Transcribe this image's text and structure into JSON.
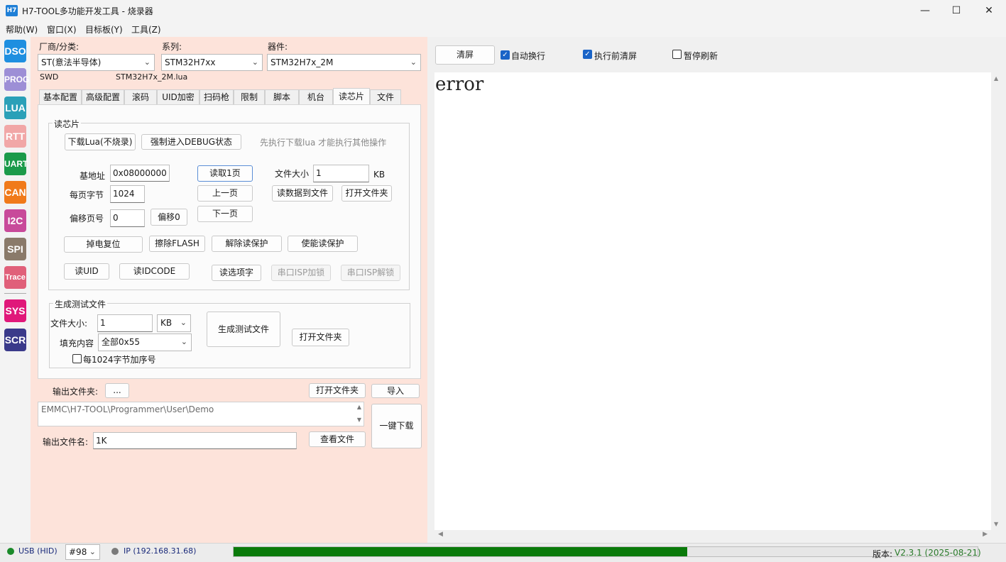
{
  "window": {
    "app_icon_text": "H7",
    "title": "H7-TOOL多功能开发工具 - 烧录器",
    "minimize": "—",
    "maximize": "☐",
    "close": "✕"
  },
  "menu": [
    {
      "label": "帮助(W)"
    },
    {
      "label": "窗口(X)"
    },
    {
      "label": "目标板(Y)"
    },
    {
      "label": "工具(Z)"
    }
  ],
  "sidebar": [
    {
      "label": "DSO",
      "color": "#1e8fe0"
    },
    {
      "label": "PROG",
      "color": "#9d8fd6"
    },
    {
      "label": "LUA",
      "color": "#2aa0b8"
    },
    {
      "label": "RTT",
      "color": "#f1a7a7"
    },
    {
      "label": "UART",
      "color": "#1a9a4a"
    },
    {
      "label": "CAN",
      "color": "#f07a1a"
    },
    {
      "label": "I2C",
      "color": "#c84a9a"
    },
    {
      "label": "SPI",
      "color": "#8a7a6a"
    },
    {
      "label": "Trace",
      "color": "#e0607a"
    },
    {
      "label": "SYS",
      "color": "#e0187a"
    },
    {
      "label": "SCR",
      "color": "#3a3a8a"
    }
  ],
  "selectors": {
    "vendor_label": "厂商/分类:",
    "vendor_value": "ST(意法半导体)",
    "series_label": "系列:",
    "series_value": "STM32H7xx",
    "device_label": "器件:",
    "device_value": "STM32H7x_2M",
    "interface": "SWD",
    "lua_file": "STM32H7x_2M.lua"
  },
  "tabs": [
    {
      "label": "基本配置"
    },
    {
      "label": "高级配置"
    },
    {
      "label": "滚码"
    },
    {
      "label": "UID加密"
    },
    {
      "label": "扫码枪"
    },
    {
      "label": "限制"
    },
    {
      "label": "脚本"
    },
    {
      "label": "机台"
    },
    {
      "label": "读芯片"
    },
    {
      "label": "文件"
    }
  ],
  "read_chip": {
    "group_title": "读芯片",
    "download_lua_btn": "下载Lua(不烧录)",
    "force_debug_btn": "强制进入DEBUG状态",
    "hint": "先执行下载lua 才能执行其他操作",
    "base_addr_label": "基地址",
    "base_addr_value": "0x08000000",
    "bytes_per_page_label": "每页字节",
    "bytes_per_page_value": "1024",
    "offset_page_label": "偏移页号",
    "offset_page_value": "0",
    "offset0_btn": "偏移0",
    "read_page_btn": "读取1页",
    "prev_page_btn": "上一页",
    "next_page_btn": "下一页",
    "file_size_label": "文件大小",
    "file_size_value": "1",
    "file_size_unit": "KB",
    "read_to_file_btn": "读数据到文件",
    "open_folder_btn": "打开文件夹",
    "power_reset_btn": "掉电复位",
    "erase_flash_btn": "擦除FLASH",
    "unprotect_btn": "解除读保护",
    "protect_btn": "使能读保护",
    "read_uid_btn": "读UID",
    "read_idcode_btn": "读IDCODE",
    "read_option_btn": "读选项字",
    "isp_lock_btn": "串口ISP加锁",
    "isp_unlock_btn": "串口ISP解锁"
  },
  "gen_test": {
    "group_title": "生成测试文件",
    "size_label": "文件大小:",
    "size_value": "1",
    "unit_value": "KB",
    "fill_label": "填充内容",
    "fill_value": "全部0x55",
    "seq_checkbox_label": "每1024字节加序号",
    "generate_btn": "生成测试文件",
    "open_folder_btn": "打开文件夹"
  },
  "output": {
    "folder_label": "输出文件夹:",
    "browse_btn": "...",
    "open_folder_btn": "打开文件夹",
    "import_btn": "导入",
    "path_value": "EMMC\\H7-TOOL\\Programmer\\User\\Demo",
    "one_click_btn": "一键下载",
    "filename_label": "输出文件名:",
    "filename_value": "1K",
    "view_file_btn": "查看文件"
  },
  "log": {
    "clear_btn": "清屏",
    "auto_wrap_label": "自动换行",
    "auto_wrap_checked": true,
    "clear_before_label": "执行前清屏",
    "clear_before_checked": true,
    "pause_label": "暂停刷新",
    "pause_checked": false,
    "text": "error"
  },
  "status": {
    "usb_label": "USB (HID)",
    "usb_color": "#1a8a2a",
    "device_num": "#98",
    "ip_label": "IP (192.168.31.68)",
    "ip_color": "#7a7a7a",
    "progress": 0.61,
    "progress_color": "#0a7a0a",
    "version_label": "版本:",
    "version_value": "V2.3.1 (2025-08-21)",
    "version_color": "#2a7a2a"
  }
}
